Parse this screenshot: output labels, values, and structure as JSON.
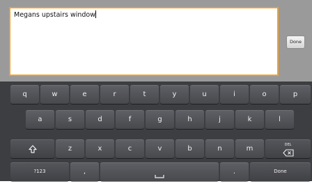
{
  "editor": {
    "text": "Megans upstairs window",
    "action_label": "Done"
  },
  "colors": {
    "focus_border": "#f0a030",
    "keyboard_bg": "#3d3e42",
    "key_bg": "#55565b"
  },
  "keyboard": {
    "row1": [
      "q",
      "w",
      "e",
      "r",
      "t",
      "y",
      "u",
      "i",
      "o",
      "p"
    ],
    "row2": [
      "a",
      "s",
      "d",
      "f",
      "g",
      "h",
      "j",
      "k",
      "l"
    ],
    "row3": {
      "shift_icon": "shift-arrow-icon",
      "letters": [
        "z",
        "x",
        "c",
        "v",
        "b",
        "n",
        "m"
      ],
      "delete_label": "DEL",
      "delete_icon": "backspace-icon"
    },
    "row4": {
      "symbols_label": "?123",
      "comma": ",",
      "space_icon": "space-bar-icon",
      "period": ".",
      "done_label": "Done"
    }
  }
}
